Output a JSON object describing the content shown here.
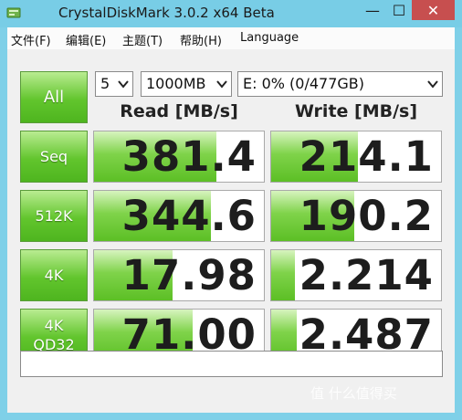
{
  "window": {
    "title": "CrystalDiskMark 3.0.2 x64 Beta",
    "minimize_glyph": "—",
    "maximize_glyph": "☐",
    "close_glyph": "✕"
  },
  "menu": [
    {
      "label": "文件(F)"
    },
    {
      "label": "编辑(E)"
    },
    {
      "label": "主题(T)"
    },
    {
      "label": "帮助(H)"
    },
    {
      "label": "Language"
    }
  ],
  "controls": {
    "all_label": "All",
    "count": "5",
    "size": "1000MB",
    "drive": "E: 0% (0/477GB)"
  },
  "headers": {
    "read": "Read [MB/s]",
    "write": "Write [MB/s]"
  },
  "rows": [
    {
      "label": "Seq",
      "read": "381.4",
      "write": "214.1",
      "read_fill": 0.72,
      "write_fill": 0.51
    },
    {
      "label": "512K",
      "read": "344.6",
      "write": "190.2",
      "read_fill": 0.69,
      "write_fill": 0.49
    },
    {
      "label": "4K",
      "read": "17.98",
      "write": "2.214",
      "read_fill": 0.46,
      "write_fill": 0.14
    },
    {
      "label": "4K\nQD32",
      "read": "71.00",
      "write": "2.487",
      "read_fill": 0.58,
      "write_fill": 0.15
    }
  ],
  "comment": "",
  "watermark": "值 什么值得买",
  "colors": {
    "accent_green": "#62c52d",
    "title_bar": "#78cde6",
    "close_red": "#c74f4f"
  }
}
